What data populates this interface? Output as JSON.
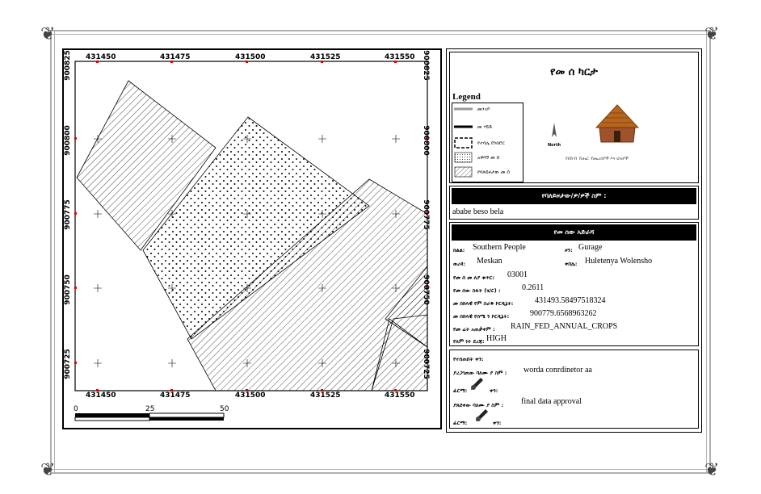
{
  "map": {
    "x_ticks": [
      "431450",
      "431475",
      "431500",
      "431525",
      "431550"
    ],
    "y_ticks": [
      "900825",
      "900800",
      "900775",
      "900750",
      "900725"
    ],
    "scale": {
      "labels": [
        "0",
        "25",
        "50"
      ]
    }
  },
  "title": "የመ ሰ ካርታ",
  "legend": {
    "title": "Legend",
    "items": [
      {
        "label": "መንገዶ",
        "symbol": "gray-line"
      },
      {
        "label": "መ ሃይድ",
        "symbol": "black-line"
      },
      {
        "label": "የተባሌ ደንበሮር",
        "symbol": "dashed-box"
      },
      {
        "label": "አዋሳኝ መ ሰ",
        "symbol": "dotted-box"
      },
      {
        "label": "የባለይዞታው መ ሰ",
        "symbol": "hatched-box"
      }
    ],
    "north_label": "North",
    "hut_caption": "የደቡብ ብሔር ብሔረሰቦች እና ህዝቦች"
  },
  "holder": {
    "header": "የባለይዞታው/ዎ/ዎች ስም :",
    "name": "ababe beso bela"
  },
  "parcel": {
    "header": "የመ ሰው አድራሻ",
    "region_label": "ክልል:",
    "region_value": "Southern People",
    "zone_label": "ዞን:",
    "zone_value": "Gurage",
    "woreda_label": "ወረዳ:",
    "woreda_value": "Meskan",
    "kebele_label": "ቀበሌ:",
    "kebele_value": "Huletenya Wolensho",
    "id_label": "የመ ሰ መ ለያ ቁጥር:",
    "id_value": "03001",
    "area_label": "የመ ሰው ስፋት (ሄ/ር) :",
    "area_value": "0.2611",
    "easting_label": "መ ስከላዊ የም ስራቅ ኮርዲኔት:",
    "easting_value": "431493.58497518324",
    "northing_label": "መ ስከላዊ የሰሜ ን ኮርዲኔት:",
    "northing_value": "900779.6568963262",
    "landuse_label": "የመ ሬት አጠቃቀም :",
    "landuse_value": "RAIN_FED_ANNUAL_CROPS",
    "fertility_label": "የለም ነት ደረጃ:",
    "fertility_value": "HIGH"
  },
  "approval": {
    "verified_label": "የተሰጠበት ቀን:",
    "prepared_label": "ያረጋገጠው ባለሙ ያ ስም :",
    "prepared_value": "worda conrdinetor aa",
    "signature_label": "ፊርማ:",
    "date_label": "ቀን:",
    "approved_label": "ያጸደቀው ባለሙ ያ ስም :",
    "approved_value": "final data approval",
    "signature2_label": "ፊርማ:",
    "date2_label": "ቀን:"
  }
}
